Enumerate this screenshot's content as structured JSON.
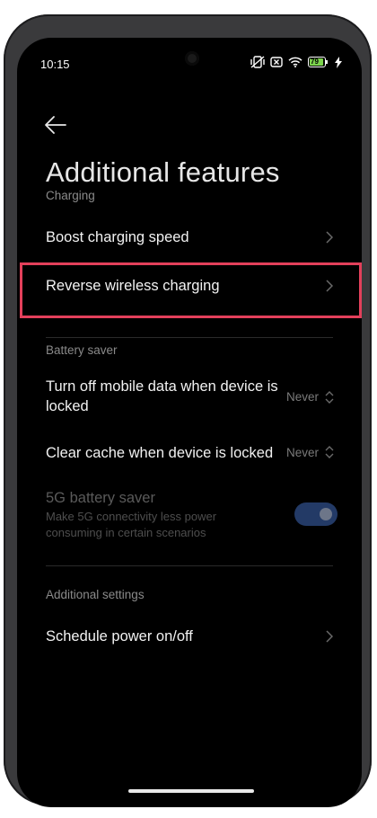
{
  "status_bar": {
    "time": "10:15",
    "battery_level": "79"
  },
  "header": {
    "back_icon": "arrow-left-icon",
    "title": "Additional features"
  },
  "sections": {
    "charging": {
      "label": "Charging",
      "items": [
        {
          "label": "Boost charging speed"
        },
        {
          "label": "Reverse wireless charging"
        }
      ]
    },
    "battery_saver": {
      "label": "Battery saver",
      "mobile_data": {
        "label": "Turn off mobile data when device is locked",
        "value": "Never"
      },
      "clear_cache": {
        "label": "Clear cache when device is locked",
        "value": "Never"
      },
      "fiveg": {
        "title": "5G battery saver",
        "subtitle": "Make 5G connectivity less power consuming in certain scenarios",
        "enabled": true
      }
    },
    "additional": {
      "label": "Additional settings",
      "items": [
        {
          "label": "Schedule power on/off"
        }
      ]
    }
  },
  "colors": {
    "background": "#000000",
    "highlight": "#e3405b",
    "toggle_on": "#233a66"
  }
}
